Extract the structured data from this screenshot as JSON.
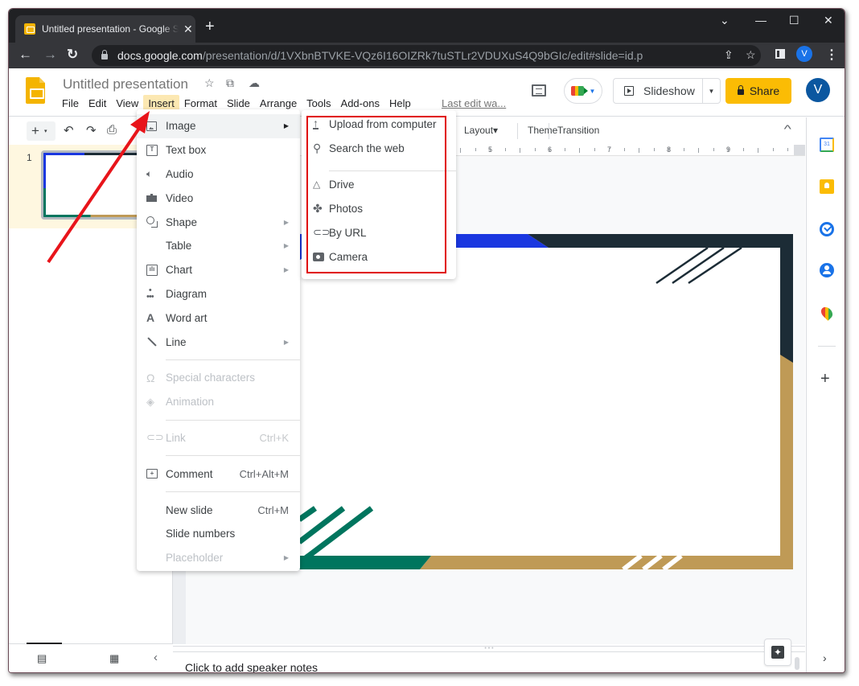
{
  "browser": {
    "tab_title": "Untitled presentation - Google Slides",
    "tab_close": "✕",
    "new_tab": "+",
    "window_controls": {
      "tab_search": "⌄",
      "minimize": "—",
      "maximize": "☐",
      "close": "✕"
    },
    "nav": {
      "back": "←",
      "forward": "→",
      "reload": "↻"
    },
    "url_host": "docs.google.com",
    "url_path": "/presentation/d/1VXbnBTVKE-VQz6I16OIZRk7tuSTLr2VDUXuS4Q9bGIc/edit#slide=id.p",
    "share_icon": "⇪",
    "bookmark_icon": "☆",
    "profile_initial": "V",
    "menu_icon": "⋮"
  },
  "app": {
    "title": "Untitled presentation",
    "title_icons": {
      "star": "☆",
      "move": "⧉",
      "cloud": "☁"
    },
    "menus": [
      "File",
      "Edit",
      "View",
      "Insert",
      "Format",
      "Slide",
      "Arrange",
      "Tools",
      "Add-ons",
      "Help"
    ],
    "active_menu": "Insert",
    "last_edit": "Last edit wa...",
    "slideshow_label": "Slideshow",
    "share_label": "Share",
    "avatar_initial": "V",
    "accent_color": "#fbbc04"
  },
  "toolbar": {
    "add": "+",
    "caret": "▾",
    "undo": "↶",
    "redo": "↷",
    "print": "⎙",
    "layout": "Layout",
    "layout_caret": "▾",
    "theme": "Theme",
    "transition": "Transition",
    "collapse": "^"
  },
  "ruler": {
    "numbers": [
      "5",
      "6",
      "7",
      "8",
      "9"
    ]
  },
  "filmstrip": {
    "slides": [
      {
        "number": "1"
      }
    ],
    "view_list_icon": "▤",
    "view_grid_icon": "▦",
    "collapse_icon": "‹"
  },
  "insert_menu": {
    "items": [
      {
        "label": "Image",
        "icon": "image",
        "submenu": true,
        "hover": true
      },
      {
        "label": "Text box",
        "icon": "text-box"
      },
      {
        "label": "Audio",
        "icon": "audio"
      },
      {
        "label": "Video",
        "icon": "video"
      },
      {
        "label": "Shape",
        "icon": "shape",
        "submenu": true
      },
      {
        "label": "Table",
        "icon": "",
        "submenu": true
      },
      {
        "label": "Chart",
        "icon": "chart",
        "submenu": true
      },
      {
        "label": "Diagram",
        "icon": "diagram"
      },
      {
        "label": "Word art",
        "icon": "word-art"
      },
      {
        "label": "Line",
        "icon": "line",
        "submenu": true
      },
      {
        "label": "Special characters",
        "icon": "omega",
        "disabled": true
      },
      {
        "label": "Animation",
        "icon": "animation",
        "disabled": true
      },
      {
        "label": "Link",
        "icon": "link",
        "shortcut": "Ctrl+K",
        "disabled": true
      },
      {
        "label": "Comment",
        "icon": "comment",
        "shortcut": "Ctrl+Alt+M"
      },
      {
        "label": "New slide",
        "icon": "",
        "shortcut": "Ctrl+M"
      },
      {
        "label": "Slide numbers",
        "icon": ""
      },
      {
        "label": "Placeholder",
        "icon": "",
        "submenu": true,
        "disabled": true
      }
    ]
  },
  "image_submenu": {
    "items": [
      {
        "label": "Upload from computer",
        "icon": "upload"
      },
      {
        "label": "Search the web",
        "icon": "search"
      },
      {
        "label": "Drive",
        "icon": "drive"
      },
      {
        "label": "Photos",
        "icon": "photos"
      },
      {
        "label": "By URL",
        "icon": "link"
      },
      {
        "label": "Camera",
        "icon": "camera"
      }
    ],
    "highlight_color": "#e00000"
  },
  "slide_theme_colors": {
    "blue": "#1a37e0",
    "dark": "#1c2c36",
    "green": "#00755e",
    "gold": "#bf9a56"
  },
  "notes": {
    "placeholder": "Click to add speaker notes"
  },
  "annotation": {
    "arrow_color": "#e8141a"
  }
}
